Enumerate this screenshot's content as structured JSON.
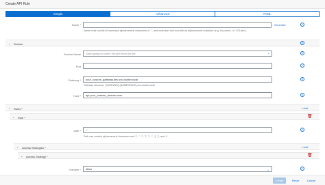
{
  "dialog": {
    "title": "Create API Rule"
  },
  "tabs": [
    {
      "label": "Simple",
      "active": true
    },
    {
      "label": "Advanced",
      "active": false
    },
    {
      "label": "YAML",
      "active": false
    }
  ],
  "name_field": {
    "label": "Name *",
    "value": "",
    "hint": "Name must consist of lowercase alphanumeric characters or '-', and must start and end with an alphanumeric character (e.g. 'my-name', or '123-abc').",
    "generate_label": "Generate"
  },
  "service_section": {
    "title": "Service",
    "service_name": {
      "label": "Service Name",
      "placeholder": "Start typing to select Service from the list"
    },
    "port": {
      "label": "Port",
      "value": ""
    },
    "gateway": {
      "label": "Gateway *",
      "value": "your_custom_gateway.dev.svc.cluster.local",
      "hint": "Gateway structure: '{GATEWAY}.{NAMESPACE}.svc.cluster.local'"
    },
    "host": {
      "label": "Host *",
      "value": "api.your_custom_domain.com"
    }
  },
  "rules_section": {
    "title": "Rules *",
    "add_label": "Add",
    "rule": {
      "title": "Rule *",
      "path": {
        "label": "path *",
        "value": "/.*",
        "hint": "Path can contain alphanumeric characters and '/', '.', '*', '?', '!', '-', '(', ')', and '='."
      },
      "access_strategies": {
        "title": "Access Strategies *",
        "add_label": "Add",
        "strategy": {
          "title": "Access Strategy *",
          "handler": {
            "label": "Handler *",
            "value": "allow"
          }
        }
      }
    }
  },
  "footer": {
    "create_label": "Create",
    "reset_label": "Reset",
    "cancel_label": "Cancel"
  }
}
